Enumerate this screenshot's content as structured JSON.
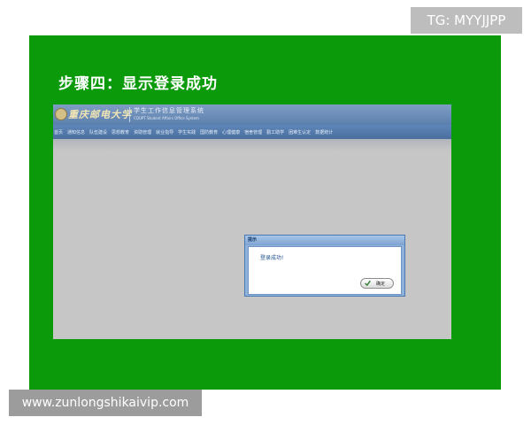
{
  "watermark": {
    "top_right": "TG: MYYJJPP",
    "bottom_left": "www.zunlongshikaivip.com"
  },
  "slide": {
    "title": "步骤四：显示登录成功",
    "background_color": "#0a9a0a"
  },
  "app": {
    "header": {
      "logo_icon": "university-emblem-icon",
      "university_name": "重庆邮电大学",
      "system_name_cn": "学生工作信息管理系统",
      "system_name_en": "CQUPT Student Affairs Office System"
    },
    "nav": {
      "items": [
        "首页",
        "通知信息",
        "队伍建设",
        "思想教育",
        "资助管理",
        "就业指导",
        "学生实践",
        "国防教育",
        "心理健康",
        "宿舍管理",
        "勤工助学",
        "困难生认定",
        "数据统计"
      ]
    }
  },
  "dialog": {
    "title": "提示",
    "message": "登录成功!",
    "ok_label": "确定",
    "ok_icon": "check-icon"
  }
}
